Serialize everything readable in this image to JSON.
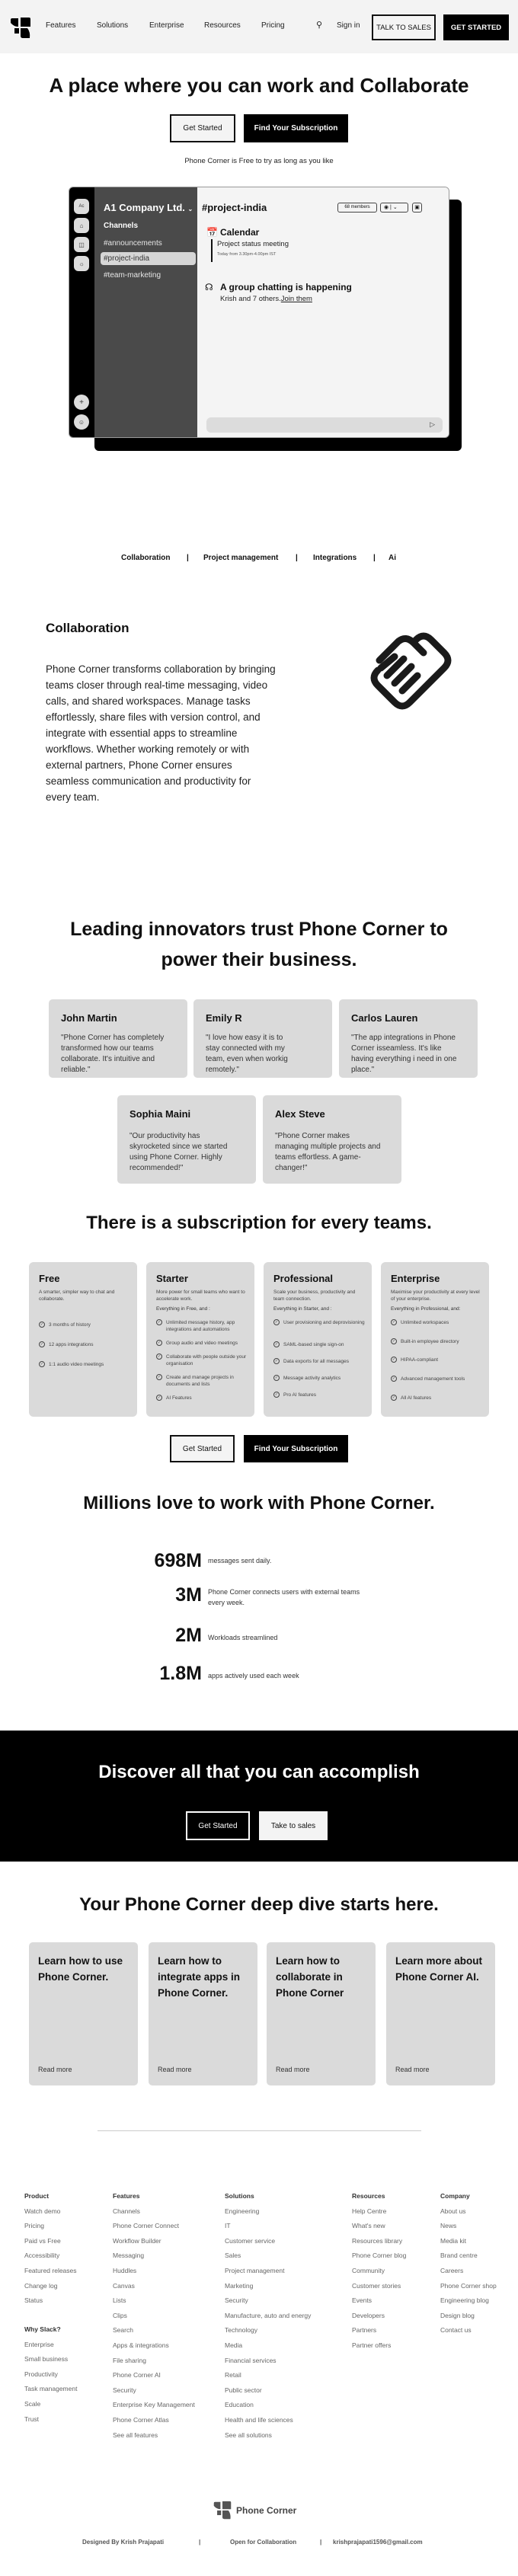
{
  "nav": {
    "links": [
      "Features",
      "Solutions",
      "Enterprise",
      "Resources",
      "Pricing"
    ],
    "sign_in": "Sign in",
    "talk_to_sales": "TALK TO SALES",
    "get_started": "GET STARTED"
  },
  "hero": {
    "title": "A place where you can work and Collaborate",
    "get_started": "Get Started",
    "find_subscription": "Find Your Subscription",
    "tagline": "Phone Corner is Free to try as long as you like"
  },
  "app_mockup": {
    "rail_avatar": "Ac",
    "workspace": "A1 Company Ltd.",
    "channels_heading": "Channels",
    "channels": [
      "#announcements",
      "#project-india",
      "#team-marketing"
    ],
    "active_channel": "#project-india",
    "members_badge": "68 members",
    "calendar_title": "Calendar",
    "meeting_title": "Project status meeting",
    "meeting_time": "Today from 3.30pm-4.00pm IST",
    "huddle_title": "A group chatting is happening",
    "huddle_text": "Krish and 7 others.",
    "huddle_link": "Join them"
  },
  "feature_tabs": [
    "Collaboration",
    "Project management",
    "Integrations",
    "Ai"
  ],
  "collaboration": {
    "title": "Collaboration",
    "body": "Phone Corner transforms collaboration by bringing teams closer through real-time messaging, video calls, and shared workspaces. Manage tasks effortlessly, share files with version control, and integrate with essential apps to streamline workflows. Whether working remotely or with external partners, Phone Corner ensures seamless communication and productivity for every team."
  },
  "testimonials": {
    "title": "Leading innovators trust Phone Corner to power their business.",
    "items": [
      {
        "name": "John Martin",
        "quote": "\"Phone Corner has completely transformed how our teams collaborate. It's intuitive and reliable.\""
      },
      {
        "name": "Emily  R",
        "quote": "\"I love how easy it is to stay connected with my team, even when workig remotely.\""
      },
      {
        "name": "Carlos Lauren",
        "quote": "\"The app integrations in Phone Corner isseamless. It's like having everything i need in one place.\""
      },
      {
        "name": "Sophia Maini",
        "quote": "\"Our productivity has skyrocketed since we started using Phone Corner. Highly recommended!\""
      },
      {
        "name": "Alex Steve",
        "quote": "\"Phone Corner makes managing multiple projects and teams effortless. A game-changer!\""
      }
    ]
  },
  "plans": {
    "title": "There is a subscription for every teams.",
    "items": [
      {
        "name": "Free",
        "desc": "A smarter, simpler way to chat and collaborate.",
        "everything": "",
        "features": [
          "3 months of history",
          "12 apps integrations",
          "1:1 audio video meetings"
        ]
      },
      {
        "name": "Starter",
        "desc": "More power for small teams who want to accelerate work.",
        "everything": "Everything in Free, and :",
        "features": [
          "Unlimited message history, app integrations and automations",
          "Group audio and video meetings",
          "Collaborate with people outside your organisation",
          "Create and manage projects in documents and lists",
          "AI Features"
        ]
      },
      {
        "name": "Professional",
        "desc": "Scale your business, productivity and team connection.",
        "everything": "Everything in Starter, and :",
        "features": [
          "User provisioning and deprovisioning",
          "SAML-based single sign-on",
          "Data exports for all messages",
          "Message activity analytics",
          "Pro AI features"
        ]
      },
      {
        "name": "Enterprise",
        "desc": "Maximise your productivity at every level of your enterprise.",
        "everything": "Everything in Professional, and:",
        "features": [
          "Unlimited workspaces",
          "Built-in employee directory",
          "HIPAA-compliant",
          "Advanced management tools",
          "All AI features"
        ]
      }
    ],
    "get_started": "Get Started",
    "find_subscription": "Find Your Subscription"
  },
  "stats": {
    "title": "Millions love to work with Phone Corner.",
    "items": [
      {
        "value": "698M",
        "label": "messages sent daily."
      },
      {
        "value": "3M",
        "label": "Phone Corner connects users with external teams every week."
      },
      {
        "value": "2M",
        "label": "Workloads streamlined"
      },
      {
        "value": "1.8M",
        "label": "apps actively used each week"
      }
    ]
  },
  "cta": {
    "title": "Discover all that you can accomplish",
    "get_started": "Get Started",
    "sales": "Take to sales"
  },
  "deep_dive": {
    "title": "Your Phone Corner deep dive starts here.",
    "items": [
      {
        "title": "Learn how to use Phone Corner.",
        "link": "Read more"
      },
      {
        "title": "Learn how to integrate apps in Phone Corner.",
        "link": "Read more"
      },
      {
        "title": "Learn how to collaborate in Phone Corner",
        "link": "Read more"
      },
      {
        "title": "Learn more about Phone Corner AI.",
        "link": "Read more"
      }
    ]
  },
  "footer": {
    "columns": [
      {
        "heading": "Product",
        "items": [
          "Watch demo",
          "Pricing",
          "Paid vs Free",
          "Accessibility",
          "Featured releases",
          "Change log",
          "Status"
        ]
      },
      {
        "heading": "Features",
        "items": [
          "Channels",
          "Phone Corner Connect",
          "Workflow Builder",
          "Messaging",
          "Huddles",
          "Canvas",
          "Lists",
          "Clips",
          "Search",
          "Apps & integrations",
          "File sharing",
          "Phone Corner AI",
          "Security",
          "Enterprise Key Management",
          "Phone Corner Atlas",
          "See all features"
        ]
      },
      {
        "heading": "Solutions",
        "items": [
          "Engineering",
          "IT",
          "Customer service",
          "Sales",
          "Project management",
          "Marketing",
          "Security",
          "Manufacture, auto and energy",
          "Technology",
          "Media",
          "Financial services",
          "Retail",
          "Public sector",
          "Education",
          "Health and life sciences",
          "See all solutions"
        ]
      },
      {
        "heading": "Resources",
        "items": [
          "Help Centre",
          "What's new",
          "Resources library",
          "Phone Corner blog",
          "Community",
          "Customer stories",
          "Events",
          "Developers",
          "Partners",
          "Partner offers"
        ]
      },
      {
        "heading": "Company",
        "items": [
          "About us",
          "News",
          "Media kit",
          "Brand centre",
          "Careers",
          "Phone Corner shop",
          "Engineering blog",
          "Design blog",
          "Contact us"
        ]
      }
    ],
    "why": {
      "heading": "Why Slack?",
      "items": [
        "Enterprise",
        "Small business",
        "Productivity",
        "Task management",
        "Scale",
        "Trust"
      ]
    },
    "brand": "Phone Corner",
    "designed_by": "Designed By Krish Prajapati",
    "open": "Open for Collaboration",
    "email": "krishprajapati1596@gmail.com"
  }
}
